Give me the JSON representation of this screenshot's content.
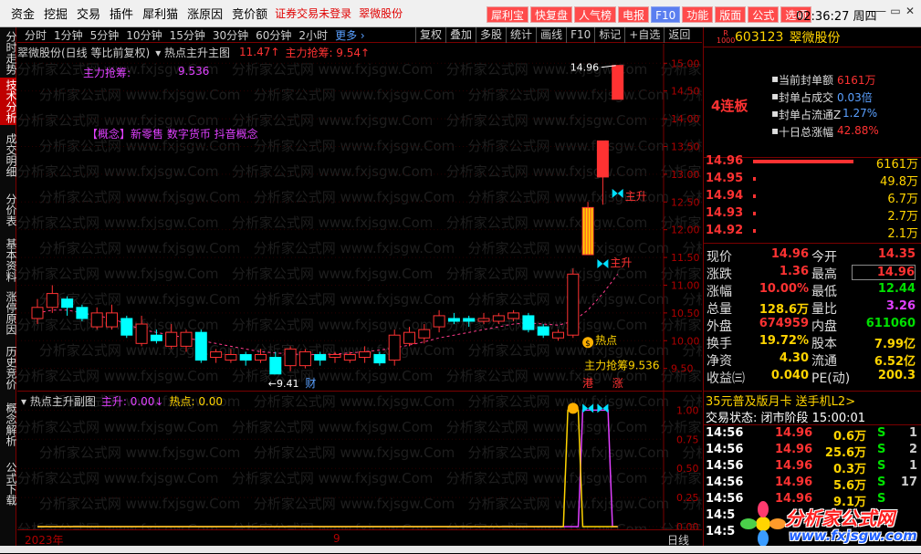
{
  "menu": {
    "items": [
      "资金",
      "挖掘",
      "交易",
      "插件",
      "犀利猫",
      "涨原因",
      "竞价额"
    ],
    "notice": "证券交易未登录",
    "stock_name": "翠微股份"
  },
  "toolbar": {
    "buttons": [
      "犀利宝",
      "快复盘",
      "人气榜",
      "电报",
      "F10",
      "功能",
      "版面",
      "公式",
      "选项"
    ],
    "clock": "02:36:27 周四"
  },
  "window_controls": [
    "—",
    "▭",
    "✕"
  ],
  "left_tabs": [
    {
      "label": "分时走势",
      "active": false
    },
    {
      "label": "技术分析",
      "active": true
    },
    {
      "label": "成交明细",
      "active": false
    },
    {
      "label": "分价表",
      "active": false
    },
    {
      "label": "基本资料",
      "active": false
    },
    {
      "label": "涨停原因",
      "active": false
    },
    {
      "label": "历史竞价",
      "active": false
    },
    {
      "label": "概念解析",
      "active": false
    },
    {
      "label": "公式下载",
      "active": false
    }
  ],
  "periods": [
    "分时",
    "1分钟",
    "5分钟",
    "10分钟",
    "15分钟",
    "30分钟",
    "60分钟",
    "2小时"
  ],
  "periods_more": "更多 ›",
  "tools": [
    "复权",
    "叠加",
    "多股",
    "统计",
    "画线",
    "F10",
    "标记",
    "+自选",
    "返回"
  ],
  "main_chart": {
    "title": "翠微股份(日线 等比前复权)",
    "indicator": "▾ 热点主升主图",
    "value1": "11.47↑",
    "value2": "主力抢筹: 9.54↑",
    "zhuli_label": "主力抢筹:",
    "zhuli_value": "9.536",
    "concept": "【概念】新零售 数字货币 抖音概念",
    "high_label": "14.96",
    "low_label": "←9.41",
    "sig_zhusheng": "主升",
    "sig_redian": "热点",
    "sig_zhuli": "主力抢筹9.536",
    "mark_cai": "财",
    "mark_gang": "港",
    "mark_zhang": "涨"
  },
  "sub_chart": {
    "title": "▾ 热点主升副图",
    "zhusheng": "主升: 0.00↓",
    "redian": "热点: 0.00"
  },
  "axis": {
    "year": "2023年",
    "month": "9",
    "period": "日线"
  },
  "stock": {
    "r_label": "R",
    "r_sub": "1000",
    "code": "603123",
    "name": "翠微股份"
  },
  "seal": {
    "lianban": "4连板",
    "rows": [
      {
        "label": "当前封单额",
        "value": "6161万",
        "color": "red"
      },
      {
        "label": "封单占成交",
        "value": "0.03倍",
        "color": "blue"
      },
      {
        "label": "封单占流通Z",
        "value": "1.27%",
        "color": "blue"
      },
      {
        "label": "十日总涨幅",
        "value": "42.88%",
        "color": "red"
      }
    ]
  },
  "orderbook": [
    {
      "price": "14.96",
      "vol": "6161万",
      "bar": 1.0
    },
    {
      "price": "14.95",
      "vol": "49.8万",
      "bar": 0.008
    },
    {
      "price": "14.94",
      "vol": "6.7万",
      "bar": 0.001
    },
    {
      "price": "14.93",
      "vol": "2.7万",
      "bar": 0.0005
    },
    {
      "price": "14.92",
      "vol": "2.1万",
      "bar": 0.0003
    }
  ],
  "quote": [
    {
      "l": "现价",
      "v": "14.96",
      "vc": "#ff3232",
      "l2": "今开",
      "v2": "14.35",
      "v2c": "#ff3232"
    },
    {
      "l": "涨跌",
      "v": "1.36",
      "vc": "#ff3232",
      "l2": "最高",
      "v2": "14.96",
      "v2c": "#ff3232"
    },
    {
      "l": "涨幅",
      "v": "10.00%",
      "vc": "#ff3232",
      "l2": "最低",
      "v2": "12.44",
      "v2c": "#00e000"
    },
    {
      "l": "总量",
      "v": "128.6万",
      "vc": "#ffd400",
      "l2": "量比",
      "v2": "3.26",
      "v2c": "#e040ff"
    },
    {
      "l": "外盘",
      "v": "674959",
      "vc": "#ff3232",
      "l2": "内盘",
      "v2": "611060",
      "v2c": "#00e000"
    },
    {
      "l": "换手",
      "v": "19.72%",
      "vc": "#ffd400",
      "l2": "股本",
      "v2": "7.99亿",
      "v2c": "#ffd400"
    },
    {
      "l": "净资",
      "v": "4.30",
      "vc": "#ffd400",
      "l2": "流通",
      "v2": "6.52亿",
      "v2c": "#ffd400"
    },
    {
      "l": "收益㈢",
      "v": "0.040",
      "vc": "#ffd400",
      "l2": "PE(动)",
      "v2": "200.3",
      "v2c": "#ffd400"
    }
  ],
  "promo": "35元普及版月卡 送手机L2>",
  "trade_state": "交易状态: 闭市阶段 15:00:01",
  "ticks": [
    {
      "t": "14:56",
      "p": "14.96",
      "v": "0.6万",
      "s": "S",
      "n": "1"
    },
    {
      "t": "14:56",
      "p": "14.96",
      "v": "25.6万",
      "s": "S",
      "n": "2"
    },
    {
      "t": "14:56",
      "p": "14.96",
      "v": "0.3万",
      "s": "S",
      "n": "1"
    },
    {
      "t": "14:56",
      "p": "14.96",
      "v": "5.6万",
      "s": "S",
      "n": "17"
    },
    {
      "t": "14:56",
      "p": "14.96",
      "v": "9.1万",
      "s": "S",
      "n": ""
    },
    {
      "t": "14:5",
      "p": "",
      "v": "",
      "s": "",
      "n": ""
    },
    {
      "t": "14:5",
      "p": "",
      "v": "",
      "s": "",
      "n": ""
    }
  ],
  "logo": {
    "text": "分析家公式网",
    "url": "www.fxjsgw.com"
  },
  "watermark": "分析家公式网 www.fxjsgw.Com",
  "colors": {
    "up": "#ff3232",
    "down": "#00ffff",
    "accent": "#ffd400",
    "magenta": "#e040ff"
  },
  "chart_data": [
    {
      "type": "candlestick",
      "title": "翠微股份(日线 等比前复权)",
      "y_ticks": [
        15.0,
        14.5,
        14.0,
        13.5,
        13.0,
        12.5,
        12.0,
        11.5,
        11.0,
        10.5,
        10.0,
        9.5
      ],
      "ylim": [
        9.1,
        15.35
      ],
      "candles": [
        {
          "o": 10.4,
          "c": 10.6,
          "h": 10.75,
          "l": 10.3
        },
        {
          "o": 10.6,
          "c": 10.85,
          "h": 11.0,
          "l": 10.5
        },
        {
          "o": 10.75,
          "c": 10.6,
          "h": 10.8,
          "l": 10.45
        },
        {
          "o": 10.6,
          "c": 10.4,
          "h": 10.65,
          "l": 10.35
        },
        {
          "o": 10.25,
          "c": 10.5,
          "h": 10.6,
          "l": 10.2
        },
        {
          "o": 10.25,
          "c": 10.5,
          "h": 10.65,
          "l": 10.2
        },
        {
          "o": 10.4,
          "c": 10.1,
          "h": 10.45,
          "l": 10.05
        },
        {
          "o": 9.95,
          "c": 10.3,
          "h": 10.45,
          "l": 9.9
        },
        {
          "o": 10.1,
          "c": 10.0,
          "h": 10.2,
          "l": 9.95
        },
        {
          "o": 9.9,
          "c": 10.15,
          "h": 10.3,
          "l": 9.85
        },
        {
          "o": 9.9,
          "c": 10.15,
          "h": 10.2,
          "l": 9.8
        },
        {
          "o": 10.15,
          "c": 9.65,
          "h": 10.2,
          "l": 9.6
        },
        {
          "o": 9.7,
          "c": 9.8,
          "h": 9.85,
          "l": 9.6
        },
        {
          "o": 9.65,
          "c": 9.75,
          "h": 9.85,
          "l": 9.6
        },
        {
          "o": 9.75,
          "c": 9.65,
          "h": 9.8,
          "l": 9.55
        },
        {
          "o": 9.65,
          "c": 9.75,
          "h": 9.85,
          "l": 9.6
        },
        {
          "o": 9.7,
          "c": 9.4,
          "h": 9.8,
          "l": 9.4
        },
        {
          "o": 9.55,
          "c": 9.85,
          "h": 9.9,
          "l": 9.45
        },
        {
          "o": 9.55,
          "c": 9.8,
          "h": 9.85,
          "l": 9.5
        },
        {
          "o": 9.75,
          "c": 9.65,
          "h": 9.8,
          "l": 9.55
        },
        {
          "o": 9.7,
          "c": 9.75,
          "h": 9.8,
          "l": 9.6
        },
        {
          "o": 9.65,
          "c": 9.75,
          "h": 9.8,
          "l": 9.6
        },
        {
          "o": 9.7,
          "c": 9.8,
          "h": 9.9,
          "l": 9.6
        },
        {
          "o": 9.75,
          "c": 9.6,
          "h": 9.8,
          "l": 9.55
        },
        {
          "o": 9.65,
          "c": 10.1,
          "h": 10.2,
          "l": 9.55
        },
        {
          "o": 9.95,
          "c": 10.15,
          "h": 10.25,
          "l": 9.9
        },
        {
          "o": 10.05,
          "c": 10.2,
          "h": 10.3,
          "l": 9.95
        },
        {
          "o": 10.25,
          "c": 10.45,
          "h": 10.55,
          "l": 10.15
        },
        {
          "o": 10.4,
          "c": 10.35,
          "h": 10.5,
          "l": 10.3
        },
        {
          "o": 10.4,
          "c": 10.35,
          "h": 10.45,
          "l": 10.25
        },
        {
          "o": 10.35,
          "c": 10.4,
          "h": 10.5,
          "l": 10.3
        },
        {
          "o": 10.35,
          "c": 10.45,
          "h": 10.5,
          "l": 10.3
        },
        {
          "o": 10.4,
          "c": 10.5,
          "h": 10.55,
          "l": 10.35
        },
        {
          "o": 10.45,
          "c": 10.2,
          "h": 10.5,
          "l": 10.15
        },
        {
          "o": 10.25,
          "c": 10.1,
          "h": 10.3,
          "l": 10.05
        },
        {
          "o": 10.05,
          "c": 10.15,
          "h": 10.2,
          "l": 10.0
        },
        {
          "o": 10.1,
          "c": 11.2,
          "h": 11.3,
          "l": 10.05
        },
        {
          "o": 11.55,
          "c": 12.4,
          "h": 12.5,
          "l": 11.55
        },
        {
          "o": 12.95,
          "c": 13.6,
          "h": 13.6,
          "l": 12.45
        },
        {
          "o": 14.35,
          "c": 14.96,
          "h": 14.96,
          "l": 14.35
        }
      ],
      "overlay": {
        "name": "主力抢筹",
        "values": [
          10.5,
          10.55,
          10.55,
          10.5,
          10.45,
          10.4,
          10.3,
          10.2,
          10.15,
          10.1,
          10.05,
          10.0,
          9.95,
          9.9,
          9.85,
          9.8,
          9.78,
          9.76,
          9.75,
          9.75,
          9.76,
          9.78,
          9.8,
          9.83,
          9.87,
          9.92,
          9.98,
          10.05,
          10.1,
          10.15,
          10.2,
          10.25,
          10.3,
          10.32,
          10.3,
          10.28,
          10.35,
          10.55,
          10.85,
          11.2
        ]
      }
    },
    {
      "type": "line",
      "title": "热点主升副图",
      "y_ticks": [
        1.0,
        0.75,
        0.5,
        0.25,
        0.0
      ],
      "ylim": [
        0,
        1.05
      ],
      "series": [
        {
          "name": "主升",
          "values": [
            0,
            0,
            0,
            0,
            0,
            0,
            0,
            0,
            0,
            0,
            0,
            0,
            0,
            0,
            0,
            0,
            0,
            0,
            0,
            0,
            0,
            0,
            0,
            0,
            0,
            0,
            0,
            0,
            0,
            0,
            0,
            0,
            0,
            0,
            0,
            0,
            0,
            1,
            1,
            0
          ]
        },
        {
          "name": "热点",
          "values": [
            0,
            0,
            0,
            0,
            0,
            0,
            0,
            0,
            0,
            0,
            0,
            0,
            0,
            0,
            0,
            0,
            0,
            0,
            0,
            0,
            0,
            0,
            0,
            0,
            0,
            0,
            0,
            0,
            0,
            0,
            0,
            0,
            0,
            0,
            0,
            0,
            1,
            0,
            0,
            0
          ]
        }
      ]
    }
  ]
}
